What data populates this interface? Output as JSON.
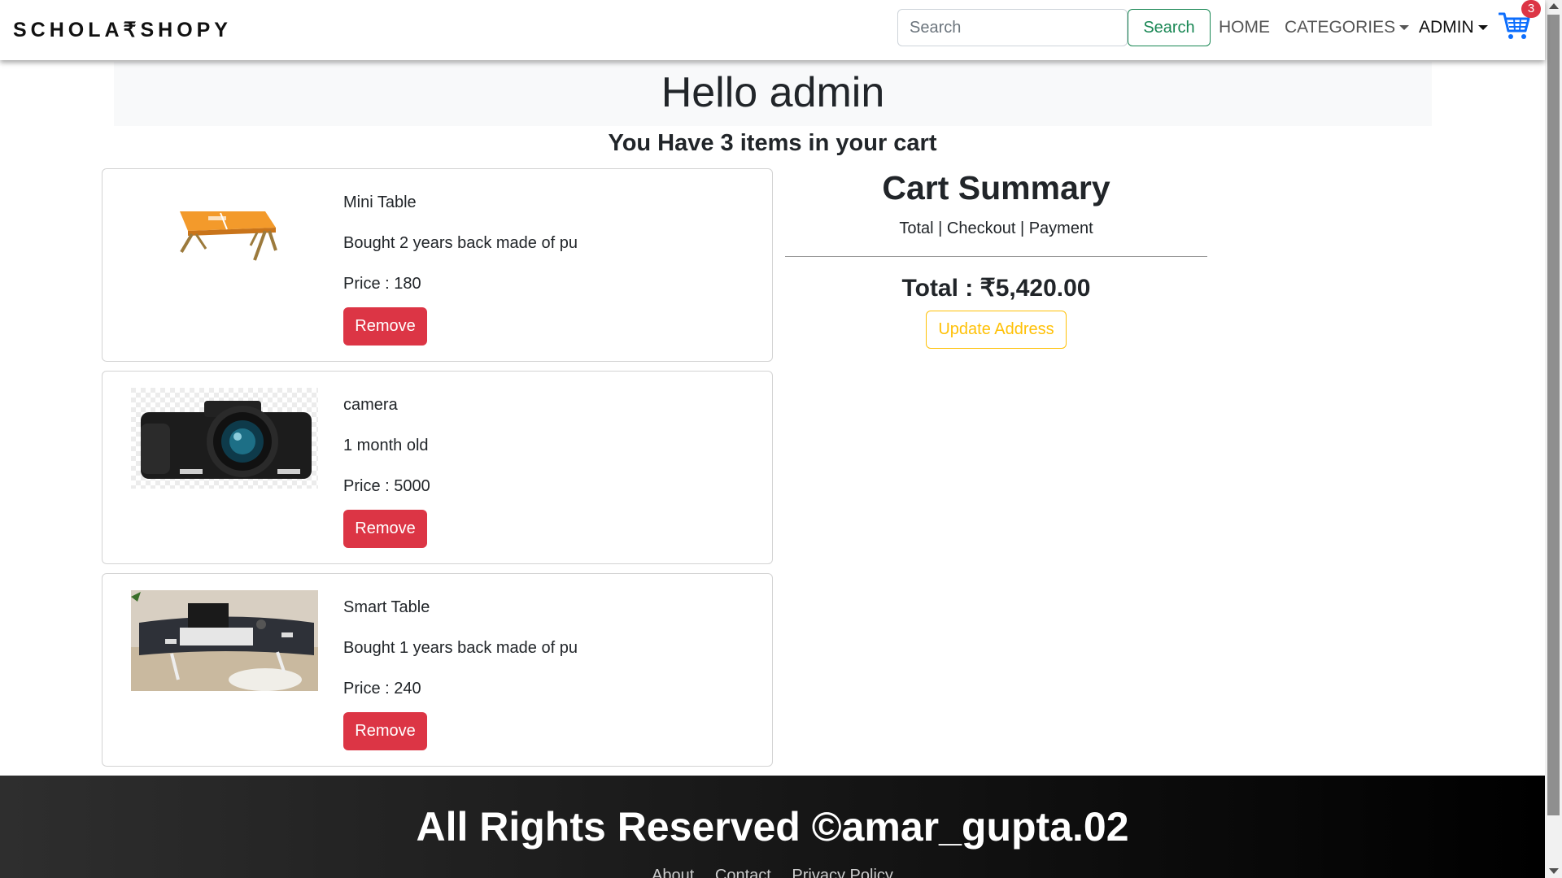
{
  "navbar": {
    "brand": "SCHOLA₹SHOPY",
    "search_placeholder": "Search",
    "search_button": "Search",
    "home": "HOME",
    "categories": "CATEGORIES",
    "admin": "ADMIN",
    "cart_icon": "cart-icon",
    "cart_count": "3"
  },
  "header": {
    "greeting": "Hello admin",
    "cart_message": "You Have 3 items in your cart"
  },
  "items": [
    {
      "name": "Mini Table",
      "description": "Bought 2 years back made of pu",
      "price": "Price : 180",
      "remove": "Remove",
      "image": "mini-table-image"
    },
    {
      "name": "camera",
      "description": "1 month old",
      "price": "Price : 5000",
      "remove": "Remove",
      "image": "camera-image"
    },
    {
      "name": "Smart Table",
      "description": "Bought 1 years back made of pu",
      "price": "Price : 240",
      "remove": "Remove",
      "image": "smart-table-image"
    }
  ],
  "summary": {
    "title": "Cart Summary",
    "subtitle": "Total | Checkout | Payment",
    "total": "Total : ₹5,420.00",
    "update_address": "Update Address"
  },
  "footer": {
    "copyright": "All Rights Reserved ©amar_gupta.02",
    "links": [
      "About",
      "Contact",
      "Privacy Policy"
    ]
  },
  "colors": {
    "danger": "#dc3545",
    "success": "#198754",
    "warning": "#ffc107",
    "cart_icon": "#0d6efd"
  }
}
